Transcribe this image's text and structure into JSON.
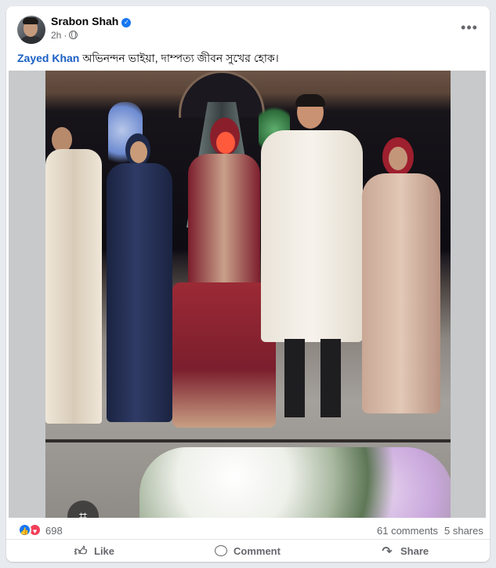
{
  "post": {
    "author": "Srabon Shah",
    "verified": true,
    "time": "2h",
    "audience_icon": "globe-icon",
    "more_icon": "ellipsis-icon",
    "caption": {
      "mention": "Zayed Khan",
      "text": " অভিনন্দন ভাইয়া, দাম্পত্য জীবন সুখের হোক।"
    }
  },
  "stats": {
    "reactions": [
      "like-icon",
      "love-icon"
    ],
    "reaction_count": "698",
    "comments": "61 comments",
    "shares": "5 shares"
  },
  "actions": {
    "like": "Like",
    "comment": "Comment",
    "share": "Share"
  },
  "colors": {
    "accent": "#1877f2",
    "love": "#f33e58",
    "mention": "#1b5fc4",
    "muted": "#65676b"
  }
}
